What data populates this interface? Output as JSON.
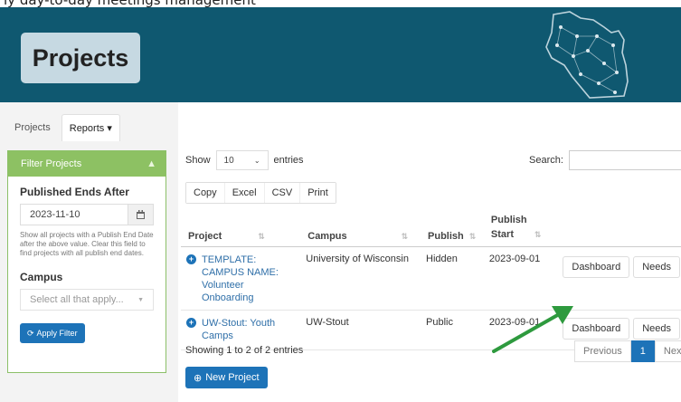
{
  "caption": "ly day-to-day meetings management",
  "header": {
    "title": "Projects",
    "logo_icon": "wisconsin-network-map-icon"
  },
  "nav": {
    "tabs": [
      {
        "label": "Projects"
      },
      {
        "label": "Reports ▾"
      }
    ]
  },
  "filter": {
    "title": "Filter Projects",
    "published_label": "Published Ends After",
    "date_value": "2023-11-10",
    "help_text": "Show all projects with a Publish End Date after the above value. Clear this field to find projects with all publish end dates.",
    "campus_label": "Campus",
    "campus_placeholder": "Select all that apply...",
    "apply_label": "Apply Filter"
  },
  "table_controls": {
    "show_label": "Show",
    "length_value": "10",
    "entries_label": "entries",
    "search_label": "Search:",
    "export_buttons": [
      "Copy",
      "Excel",
      "CSV",
      "Print"
    ]
  },
  "table": {
    "columns": [
      "Project",
      "Campus",
      "Publish",
      "Publish Start"
    ],
    "rows": [
      {
        "project": "TEMPLATE: CAMPUS NAME: Volunteer Onboarding",
        "campus": "University of Wisconsin",
        "publish": "Hidden",
        "start": "2023-09-01",
        "actions": [
          "Dashboard",
          "Needs"
        ]
      },
      {
        "project": "UW-Stout: Youth Camps",
        "campus": "UW-Stout",
        "publish": "Public",
        "start": "2023-09-01",
        "actions": [
          "Dashboard",
          "Needs"
        ]
      }
    ],
    "info": "Showing 1 to 2 of 2 entries"
  },
  "pagination": {
    "previous": "Previous",
    "current": "1",
    "next": "Next"
  },
  "new_project_label": "New Project",
  "colors": {
    "banner": "#0f5870",
    "accent_green": "#8dc163",
    "primary_blue": "#1d73b8",
    "arrow_green": "#2e9a3e"
  }
}
